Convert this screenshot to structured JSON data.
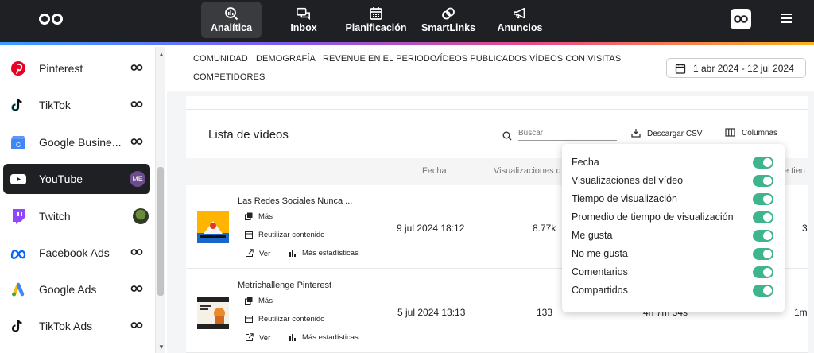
{
  "topnav": {
    "items": [
      {
        "label": "Analítica",
        "icon": "analytics-icon",
        "active": true
      },
      {
        "label": "Inbox",
        "icon": "inbox-icon"
      },
      {
        "label": "Planificación",
        "icon": "calendar-icon"
      },
      {
        "label": "SmartLinks",
        "icon": "link-icon"
      },
      {
        "label": "Anuncios",
        "icon": "megaphone-icon"
      }
    ]
  },
  "sidebar": {
    "items": [
      {
        "label": "Pinterest",
        "icon": "pinterest-icon",
        "status": "link-icon"
      },
      {
        "label": "TikTok",
        "icon": "tiktok-icon",
        "status": "link-icon"
      },
      {
        "label": "Google Busine...",
        "icon": "google-business-icon",
        "status": "link-icon"
      },
      {
        "label": "YouTube",
        "icon": "youtube-icon",
        "badge": "ME",
        "active": true
      },
      {
        "label": "Twitch",
        "icon": "twitch-icon",
        "status": "profile-photo"
      },
      {
        "label": "Facebook Ads",
        "icon": "meta-icon",
        "status": "link-icon"
      },
      {
        "label": "Google Ads",
        "icon": "google-ads-icon",
        "status": "link-icon"
      },
      {
        "label": "TikTok Ads",
        "icon": "tiktok-icon",
        "status": "link-icon"
      }
    ]
  },
  "tabs": [
    "COMUNIDAD",
    "DEMOGRAFÍA",
    "REVENUE EN EL PERIODO",
    "VÍDEOS PUBLICADOS",
    "VÍDEOS CON VISITAS",
    "COMPETIDORES"
  ],
  "date_range": "1 abr 2024 - 12 jul 2024",
  "list": {
    "title": "Lista de vídeos",
    "search_placeholder": "Buscar",
    "csv_label": "Descargar CSV",
    "columns_label": "Columnas",
    "headers": {
      "date": "Fecha",
      "views": "Visualizaciones d",
      "watch": "e tien"
    },
    "actions": {
      "more": "Más",
      "reuse": "Reutilizar contenido",
      "view": "Ver",
      "stats": "Más estadísticas"
    },
    "rows": [
      {
        "title": "Las Redes Sociales Nunca ...",
        "date": "9 jul 2024 18:12",
        "views": "8.77k",
        "watch": "",
        "last": "3"
      },
      {
        "title": "Metrichallenge Pinterest",
        "date": "5 jul 2024 13:13",
        "views": "133",
        "watch": "4h 7m 34s",
        "last": "1m"
      }
    ]
  },
  "columns_menu": {
    "options": [
      {
        "label": "Fecha",
        "on": true
      },
      {
        "label": "Visualizaciones del vídeo",
        "on": true
      },
      {
        "label": "Tiempo de visualización",
        "on": true
      },
      {
        "label": "Promedio de tiempo de visualización",
        "on": true
      },
      {
        "label": "Me gusta",
        "on": true
      },
      {
        "label": "No me gusta",
        "on": true
      },
      {
        "label": "Comentarios",
        "on": true
      },
      {
        "label": "Compartidos",
        "on": true
      }
    ]
  },
  "colors": {
    "toggle_on": "#3fb58d",
    "topbar": "#1f2023",
    "active_sidebar": "#1f2023"
  }
}
